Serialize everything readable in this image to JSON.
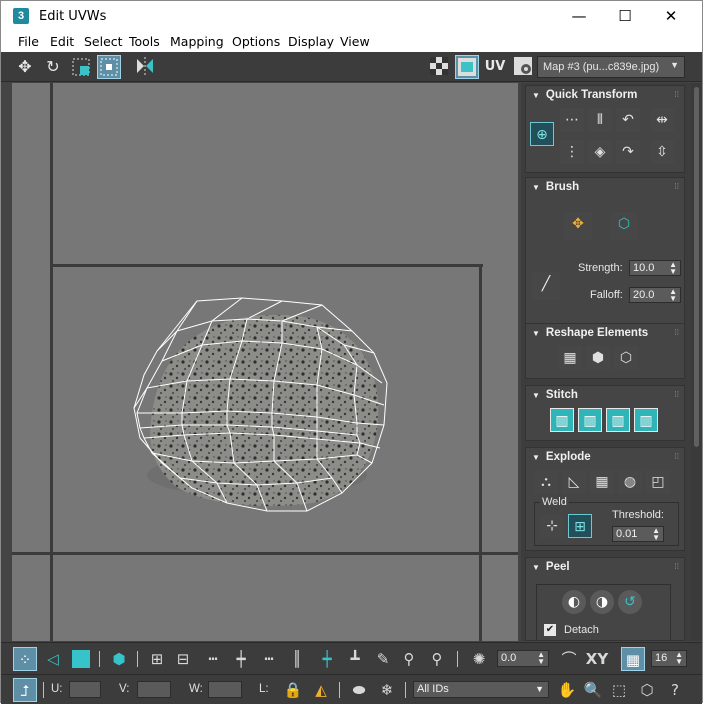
{
  "window": {
    "title": "Edit UVWs",
    "app_icon": "3",
    "minimize_glyph": "—",
    "maximize_glyph": "☐",
    "close_glyph": "✕"
  },
  "menu": [
    "File",
    "Edit",
    "Select",
    "Tools",
    "Mapping",
    "Options",
    "Display",
    "View"
  ],
  "top_toolbar": {
    "uv_label": "UV",
    "map_dropdown": "Map #3 (pu...c839e.jpg)"
  },
  "panel": {
    "quick_transform": {
      "title": "Quick Transform"
    },
    "brush": {
      "title": "Brush",
      "strength_label": "Strength:",
      "strength_value": "10.0",
      "falloff_label": "Falloff:",
      "falloff_value": "20.0"
    },
    "reshape": {
      "title": "Reshape Elements"
    },
    "stitch": {
      "title": "Stitch"
    },
    "explode": {
      "title": "Explode",
      "weld_label": "Weld",
      "threshold_label": "Threshold:",
      "threshold_value": "0.01"
    },
    "peel": {
      "title": "Peel",
      "detach_label": "Detach",
      "detach_checked": true
    }
  },
  "bottom_toolbar": {
    "angle_value": "0.0",
    "xy_label": "XY",
    "grid_value": "16",
    "u_label": "U:",
    "v_label": "V:",
    "w_label": "W:",
    "l_label": "L:",
    "ids_dropdown": "All IDs"
  },
  "colors": {
    "accent_teal": "#2fb5b7",
    "active_button": "#5f8fa6",
    "viewport_bg": "#777777"
  }
}
